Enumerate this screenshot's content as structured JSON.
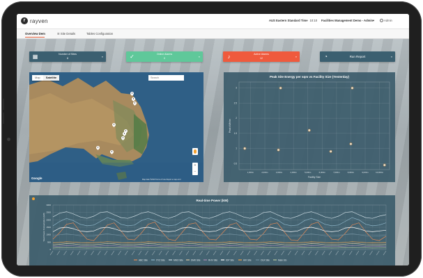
{
  "app": {
    "logo_mark": "r",
    "logo_text": "rayven",
    "timezone": "AUS Eastern Standard Time",
    "time": "10:10",
    "user_org": "Facilities Management Demo - Admin",
    "admin_label": "Admin"
  },
  "tabs": [
    {
      "label": "Overview Dem",
      "active": true
    },
    {
      "label": "☰ Site Details",
      "active": false
    },
    {
      "label": "Tables Configuration",
      "active": false
    }
  ],
  "kpis": [
    {
      "label": "Number of Sites",
      "value": "8",
      "color": "#3b5f70",
      "icon": "building-icon"
    },
    {
      "label": "Online Alarms",
      "value": "0",
      "color": "#5fc89a",
      "icon": "check-icon"
    },
    {
      "label": "Active Alarms",
      "value": "12",
      "color": "#ef5a3d",
      "icon": "bell-icon"
    },
    {
      "label": "Run Report",
      "value": "",
      "color": "#3b5f70",
      "icon": "pie-chart-icon"
    }
  ],
  "map": {
    "toggle": [
      "Map",
      "Satellite"
    ],
    "search_placeholder": "Search",
    "attribution": "Google",
    "footer": "Map data ©2019  Terms of Use  Report a map error"
  },
  "peak_chart": {
    "title": "Peak Site Energy per sqm vs Facility Size (Yesterday)"
  },
  "realtime_chart": {
    "title": "Real-time Power (kW)"
  },
  "chart_data": [
    {
      "type": "scatter",
      "title": "Peak Site Energy per sqm vs Facility Size (Yesterday)",
      "xlabel": "Facility Size",
      "ylabel": "Peak kWh/m²",
      "x_ticks": [
        "1,000m",
        "2,000m",
        "3,000m",
        "4,000m",
        "5,000m",
        "6,000m",
        "7,000m",
        "8,000m",
        "9,000m",
        "10,000m"
      ],
      "y_ticks": [
        "0.5",
        "1",
        "1.5",
        "2",
        "2.5",
        "3"
      ],
      "ylim": [
        0.3,
        3.2
      ],
      "xlim": [
        0,
        10500
      ],
      "grid": true,
      "points": [
        {
          "x": 400,
          "y": 1.0
        },
        {
          "x": 2900,
          "y": 3.0
        },
        {
          "x": 2750,
          "y": 0.95
        },
        {
          "x": 4900,
          "y": 1.6
        },
        {
          "x": 6400,
          "y": 0.9
        },
        {
          "x": 7800,
          "y": 1.15
        },
        {
          "x": 7900,
          "y": 3.0
        },
        {
          "x": 10150,
          "y": 0.45
        }
      ]
    },
    {
      "type": "line",
      "title": "Real-time Power (kW)",
      "ylabel": "Total Power Consumption (kW)",
      "ylim": [
        0,
        3000
      ],
      "y_ticks": [
        "0",
        "500",
        "1000",
        "1500",
        "2000",
        "2500",
        "3000"
      ],
      "x_ticks_count": 50,
      "series": [
        {
          "name": "ABC Site",
          "color": "#e58a56",
          "values": [
            700,
            1150,
            1700,
            1800,
            1200,
            700,
            600,
            1100,
            1650,
            1800,
            1250,
            700,
            650,
            1100,
            1700,
            1850,
            1200,
            700,
            600,
            1150,
            1700,
            1800,
            1200,
            700,
            650,
            1150,
            1650,
            1800,
            1250,
            700,
            650,
            1100,
            1700,
            1800,
            1200,
            650,
            600,
            1150,
            1700,
            1850,
            1200,
            700,
            650,
            1100,
            1650,
            1800,
            1200,
            700,
            600,
            900
          ]
        },
        {
          "name": "XYZ Site",
          "color": "#8fb6c9",
          "values": [
            1600,
            1900,
            2100,
            1950,
            1700,
            1600,
            1650,
            1900,
            2150,
            2000,
            1700,
            1600,
            1650,
            1950,
            2100,
            1950,
            1700,
            1600,
            1650,
            1900,
            2150,
            2000,
            1700,
            1600,
            1650,
            1950,
            2100,
            1950,
            1700,
            1600,
            1650,
            1900,
            2150,
            2000,
            1700,
            1600,
            1650,
            1950,
            2100,
            1950,
            1700,
            1600,
            1650,
            1900,
            2150,
            2000,
            1700,
            1600,
            1650,
            1800
          ]
        },
        {
          "name": "MNO Site",
          "color": "#c9d9e0",
          "values": [
            2200,
            2450,
            2550,
            2400,
            2200,
            2100,
            2250,
            2500,
            2550,
            2350,
            2150,
            2100,
            2250,
            2450,
            2550,
            2400,
            2200,
            2100,
            2250,
            2500,
            2550,
            2350,
            2150,
            2100,
            2250,
            2450,
            2550,
            2400,
            2200,
            2100,
            2250,
            2500,
            2550,
            2350,
            2150,
            2100,
            2250,
            2450,
            2550,
            2400,
            2200,
            2100,
            2250,
            2500,
            2550,
            2350,
            2150,
            2100,
            2250,
            2350
          ]
        },
        {
          "name": "DMK Site",
          "color": "#d7c8a4",
          "values": [
            300,
            350,
            400,
            380,
            320,
            300,
            310,
            360,
            410,
            380,
            320,
            300,
            310,
            350,
            400,
            380,
            320,
            300,
            310,
            360,
            410,
            380,
            320,
            300,
            310,
            350,
            400,
            380,
            320,
            300,
            310,
            360,
            410,
            380,
            320,
            300,
            310,
            350,
            400,
            380,
            320,
            300,
            310,
            360,
            410,
            380,
            320,
            300,
            310,
            330
          ]
        },
        {
          "name": "RHV Site",
          "color": "#a78bb3",
          "values": [
            200,
            230,
            260,
            250,
            210,
            200,
            205,
            235,
            265,
            250,
            210,
            200,
            205,
            230,
            260,
            250,
            210,
            200,
            205,
            235,
            265,
            250,
            210,
            200,
            205,
            230,
            260,
            250,
            210,
            200,
            205,
            235,
            265,
            250,
            210,
            200,
            205,
            230,
            260,
            250,
            210,
            200,
            205,
            235,
            265,
            250,
            210,
            200,
            205,
            220
          ]
        },
        {
          "name": "IOP Site",
          "color": "#ffffff",
          "values": [
            1200,
            1450,
            1500,
            1400,
            1250,
            1200,
            1250,
            1450,
            1500,
            1400,
            1250,
            1200,
            1250,
            1450,
            1500,
            1400,
            1250,
            1200,
            1250,
            1450,
            1500,
            1400,
            1250,
            1200,
            1250,
            1450,
            1500,
            1400,
            1250,
            1200,
            1250,
            1450,
            1500,
            1400,
            1250,
            1200,
            1250,
            1450,
            1500,
            1400,
            1250,
            1200,
            1250,
            1450,
            1500,
            1400,
            1250,
            1200,
            1250,
            1300
          ]
        },
        {
          "name": "HIK Site",
          "color": "#f0a14a",
          "values": [
            450,
            480,
            520,
            500,
            460,
            450,
            455,
            485,
            525,
            500,
            460,
            450,
            455,
            480,
            520,
            500,
            460,
            450,
            455,
            485,
            525,
            500,
            460,
            450,
            455,
            480,
            520,
            500,
            460,
            450,
            455,
            485,
            525,
            500,
            460,
            450,
            455,
            480,
            520,
            500,
            460,
            450,
            455,
            485,
            525,
            500,
            460,
            450,
            455,
            470
          ]
        },
        {
          "name": "OLR Site",
          "color": "#6f8f9e",
          "values": [
            900,
            1000,
            1050,
            1000,
            930,
            900,
            920,
            1010,
            1060,
            1000,
            930,
            900,
            920,
            1000,
            1050,
            1000,
            930,
            900,
            920,
            1010,
            1060,
            1000,
            930,
            900,
            920,
            1000,
            1050,
            1000,
            930,
            900,
            920,
            1010,
            1060,
            1000,
            930,
            900,
            920,
            1000,
            1050,
            1000,
            930,
            900,
            920,
            1010,
            1060,
            1000,
            930,
            900,
            920,
            950
          ]
        },
        {
          "name": "Main SG",
          "color": "#b5c8a0",
          "values": [
            100,
            120,
            130,
            125,
            110,
            100,
            105,
            122,
            132,
            125,
            110,
            100,
            105,
            120,
            130,
            125,
            110,
            100,
            105,
            122,
            132,
            125,
            110,
            100,
            105,
            120,
            130,
            125,
            110,
            100,
            105,
            122,
            132,
            125,
            110,
            100,
            105,
            120,
            130,
            125,
            110,
            100,
            105,
            122,
            132,
            125,
            110,
            100,
            105,
            110
          ]
        }
      ]
    }
  ]
}
